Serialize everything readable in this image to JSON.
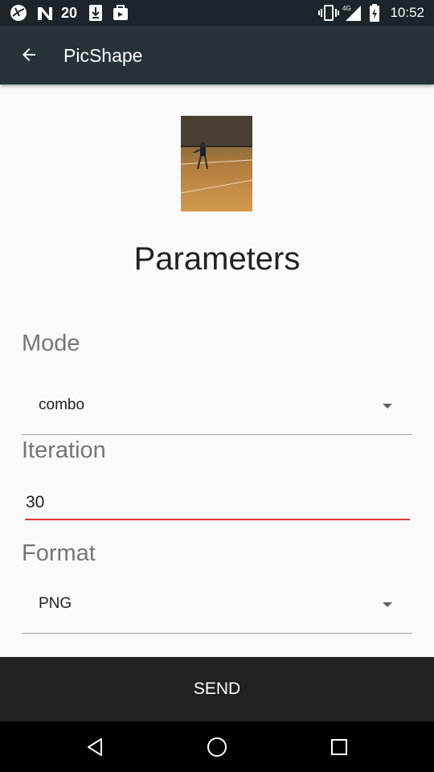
{
  "status_bar": {
    "time": "10:52",
    "left_icons": [
      "sport-icon",
      "n-icon",
      "20-minutes-icon",
      "download-icon",
      "store-icon"
    ],
    "right_icons": [
      "vibrate-icon",
      "signal-4g-icon",
      "battery-charging-icon"
    ],
    "badge_text": "20"
  },
  "app_bar": {
    "title": "PicShape"
  },
  "content": {
    "heading": "Parameters",
    "mode": {
      "label": "Mode",
      "value": "combo"
    },
    "iteration": {
      "label": "Iteration",
      "value": "30"
    },
    "format": {
      "label": "Format",
      "value": "PNG"
    }
  },
  "send_button": {
    "label": "SEND"
  },
  "colors": {
    "app_bar": "#263238",
    "status_bar": "#1b252b",
    "accent": "#e53935",
    "send_bar": "#212121"
  }
}
